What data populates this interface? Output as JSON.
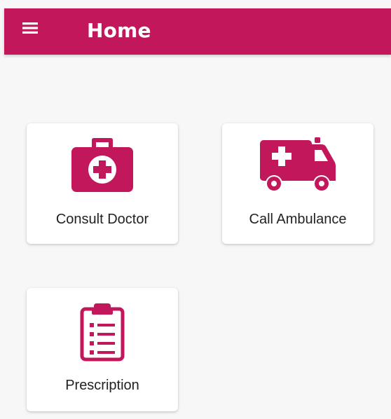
{
  "app_bar": {
    "title": "Home",
    "menu_icon": "hamburger-menu-icon"
  },
  "cards": [
    {
      "label": "Consult Doctor",
      "icon": "medical-kit-icon"
    },
    {
      "label": "Call Ambulance",
      "icon": "ambulance-icon"
    },
    {
      "label": "Prescription",
      "icon": "clipboard-list-icon"
    }
  ],
  "colors": {
    "primary": "#c2185b",
    "background": "#f7f7f7",
    "card": "#ffffff",
    "text": "#222222"
  }
}
